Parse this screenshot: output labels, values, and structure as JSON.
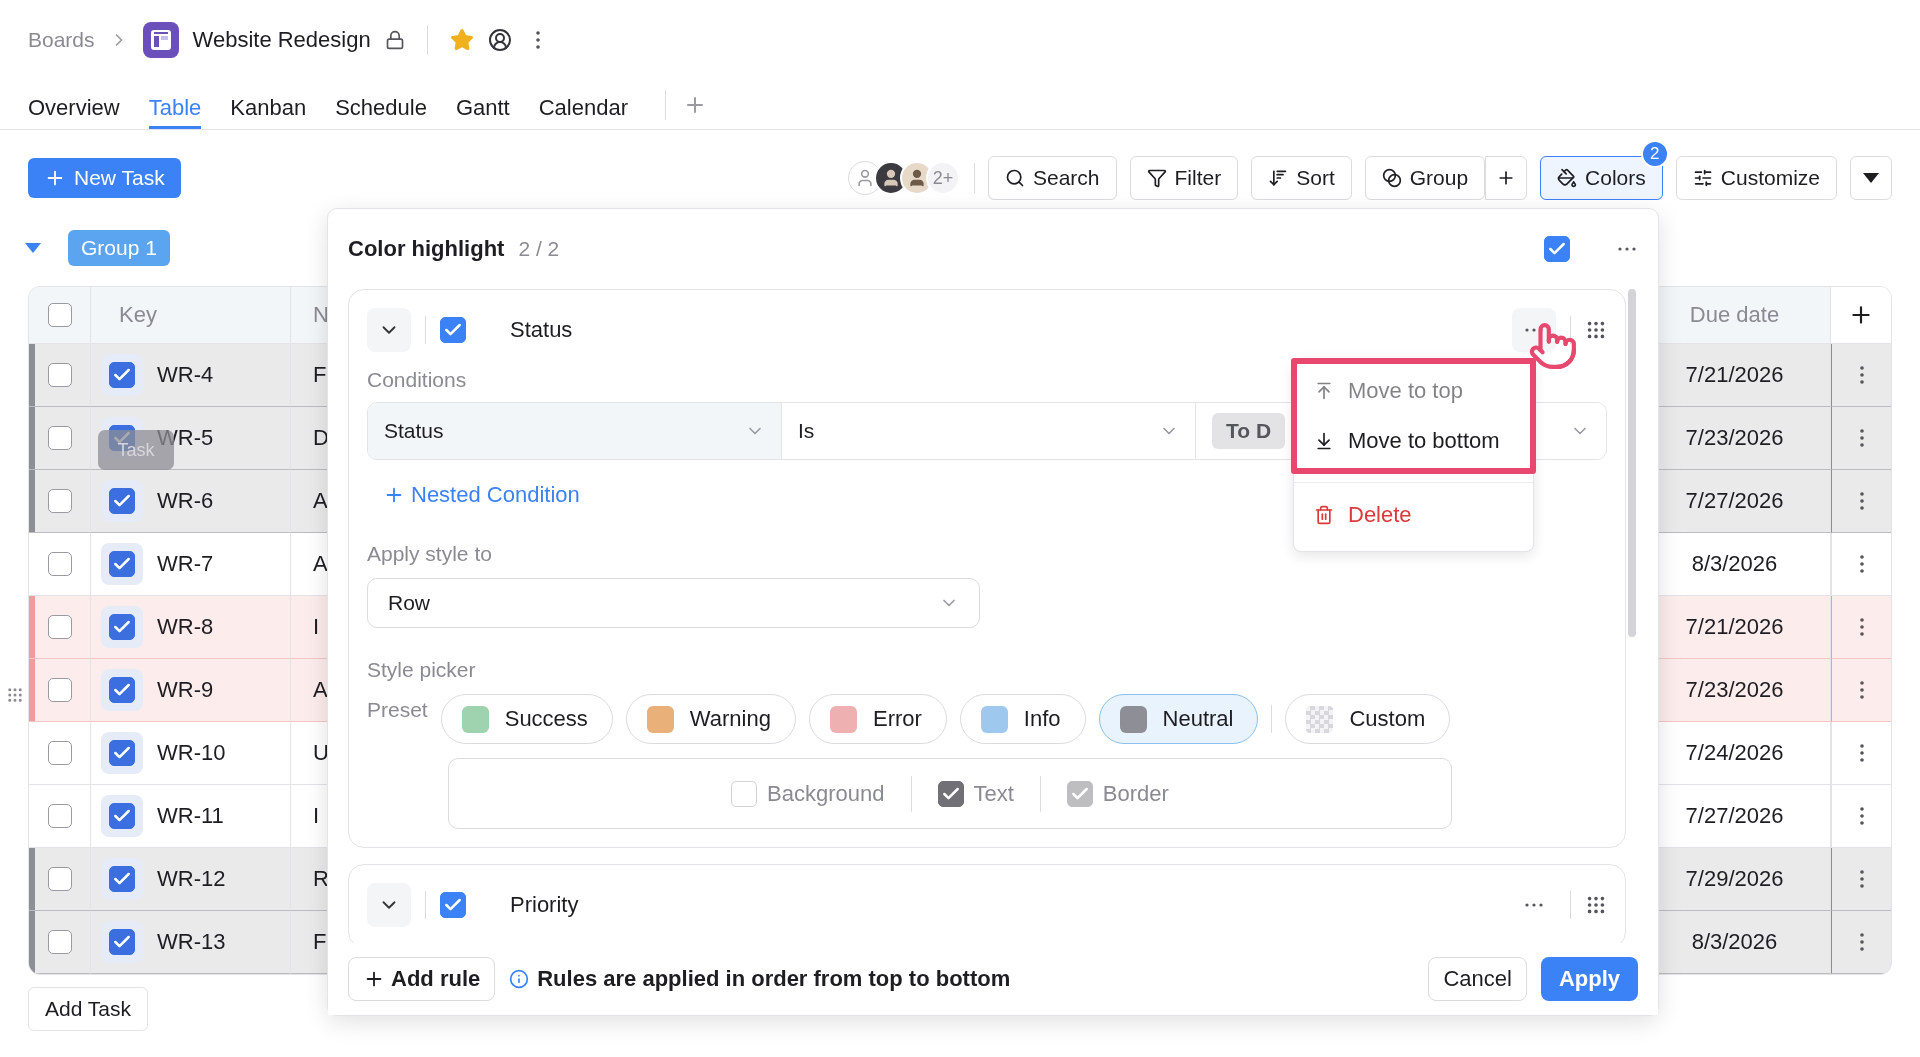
{
  "breadcrumb": {
    "parent": "Boards",
    "title": "Website Redesign",
    "starred": true
  },
  "tabs": [
    {
      "label": "Overview",
      "selected": false
    },
    {
      "label": "Table",
      "selected": true
    },
    {
      "label": "Kanban",
      "selected": false
    },
    {
      "label": "Schedule",
      "selected": false
    },
    {
      "label": "Gantt",
      "selected": false
    },
    {
      "label": "Calendar",
      "selected": false
    }
  ],
  "toolbar": {
    "new_task": "New Task",
    "more_avatars": "2+",
    "buttons": [
      {
        "kind": "search",
        "label": "Search",
        "selected": false
      },
      {
        "kind": "filter",
        "label": "Filter",
        "selected": false
      },
      {
        "kind": "sort",
        "label": "Sort",
        "selected": false
      },
      {
        "kind": "group",
        "label": "Group",
        "selected": false
      },
      {
        "kind": "add",
        "selected": false
      },
      {
        "kind": "colors",
        "label": "Colors",
        "selected": true,
        "badge": "2"
      },
      {
        "kind": "customize",
        "label": "Customize",
        "selected": false
      }
    ]
  },
  "group": {
    "label": "Group 1"
  },
  "table": {
    "all_selected": false,
    "columns": [
      "Key",
      "N",
      "Due date"
    ],
    "rows": [
      {
        "key": "WR-4",
        "name": "F",
        "due": "7/21/2026",
        "color": "#8e8e96",
        "selected": false,
        "checked": true
      },
      {
        "key": "WR-5",
        "name": "D",
        "due": "7/23/2026",
        "color": "#8e8e96",
        "selected": false,
        "checked": true
      },
      {
        "key": "WR-6",
        "name": "A",
        "due": "7/27/2026",
        "color": "#8e8e96",
        "selected": false,
        "checked": true
      },
      {
        "key": "WR-7",
        "name": "A",
        "due": "8/3/2026",
        "selected": false,
        "checked": true
      },
      {
        "key": "WR-8",
        "name": "I",
        "due": "7/21/2026",
        "color": "#ee9c9c",
        "selected": false,
        "checked": true
      },
      {
        "key": "WR-9",
        "name": "A",
        "due": "7/23/2026",
        "color": "#ee9c9c",
        "selected": false,
        "checked": true
      },
      {
        "key": "WR-10",
        "name": "U",
        "due": "7/24/2026",
        "selected": false,
        "checked": true
      },
      {
        "key": "WR-11",
        "name": "I",
        "due": "7/27/2026",
        "selected": false,
        "checked": true
      },
      {
        "key": "WR-12",
        "name": "R",
        "due": "7/29/2026",
        "color": "#8e8e96",
        "selected": false,
        "checked": true
      },
      {
        "key": "WR-13",
        "name": "F",
        "due": "8/3/2026",
        "color": "#8e8e96",
        "selected": false,
        "checked": true
      }
    ]
  },
  "tooltip": "Task",
  "add_task": "Add Task",
  "panel": {
    "title": "Color highlight",
    "count": "2 / 2",
    "enabled": true,
    "rules": [
      {
        "name": "Status",
        "enabled": true,
        "conditions_label": "Conditions",
        "condition": {
          "field": "Status",
          "operator": "Is",
          "value": "To D"
        },
        "nested": "Nested Condition",
        "apply_label": "Apply style to",
        "apply_value": "Row",
        "style_label": "Style picker",
        "preset_label": "Preset",
        "presets": [
          {
            "label": "Success",
            "color": "#9fd3b0",
            "selected": false
          },
          {
            "label": "Warning",
            "color": "#eab07a",
            "selected": false
          },
          {
            "label": "Error",
            "color": "#eeb0b0",
            "selected": false
          },
          {
            "label": "Info",
            "color": "#9fc8ee",
            "selected": false
          },
          {
            "label": "Neutral",
            "color": "#8e8e96",
            "selected": true
          }
        ],
        "custom": {
          "label": "Custom",
          "selected": false
        },
        "targets": [
          {
            "label": "Background",
            "checked": false,
            "disabled": true
          },
          {
            "label": "Text",
            "checked": true,
            "disabled": false
          },
          {
            "label": "Border",
            "checked": true,
            "disabled": true
          }
        ]
      },
      {
        "name": "Priority",
        "enabled": true
      }
    ],
    "menu": [
      {
        "kind": "top",
        "label": "Move to top",
        "disabled": true
      },
      {
        "kind": "bottom",
        "label": "Move to bottom",
        "disabled": false
      },
      {
        "kind": "delete",
        "label": "Delete",
        "disabled": false
      }
    ],
    "add_rule": "Add rule",
    "hint": "Rules are applied in order from top to bottom",
    "cancel": "Cancel",
    "apply": "Apply"
  }
}
